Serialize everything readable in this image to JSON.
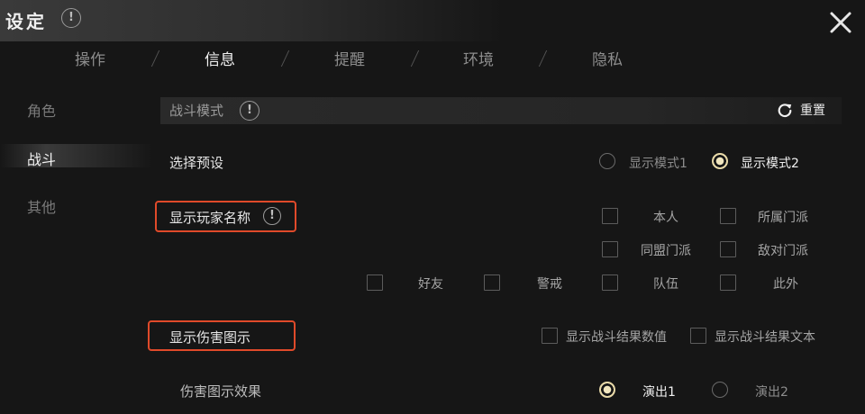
{
  "window": {
    "title": "设定"
  },
  "tabs": [
    {
      "label": "操作",
      "active": false
    },
    {
      "label": "信息",
      "active": true
    },
    {
      "label": "提醒",
      "active": false
    },
    {
      "label": "环境",
      "active": false
    },
    {
      "label": "隐私",
      "active": false
    }
  ],
  "sidebar": {
    "items": [
      {
        "label": "角色",
        "active": false
      },
      {
        "label": "战斗",
        "active": true
      },
      {
        "label": "其他",
        "active": false
      }
    ]
  },
  "section": {
    "title": "战斗模式",
    "reset_label": "重置"
  },
  "preset": {
    "label": "选择预设",
    "options": [
      {
        "label": "显示模式1",
        "selected": false
      },
      {
        "label": "显示模式2",
        "selected": true
      }
    ]
  },
  "player_names": {
    "label": "显示玩家名称",
    "options": [
      "本人",
      "所属门派",
      "同盟门派",
      "敌对门派",
      "好友",
      "警戒",
      "队伍",
      "此外"
    ]
  },
  "damage": {
    "label": "显示伤害图示",
    "checkboxes": [
      "显示战斗结果数值",
      "显示战斗结果文本"
    ],
    "effect_label": "伤害图示效果",
    "effect_options": [
      {
        "label": "演出1",
        "selected": true
      },
      {
        "label": "演出2",
        "selected": false
      }
    ]
  },
  "colors": {
    "accent": "#e8d9a8",
    "highlight": "#e04a2a",
    "background": "#161616"
  },
  "icons": {
    "title_info": "info-icon",
    "close": "close-icon",
    "reset": "refresh-icon"
  }
}
